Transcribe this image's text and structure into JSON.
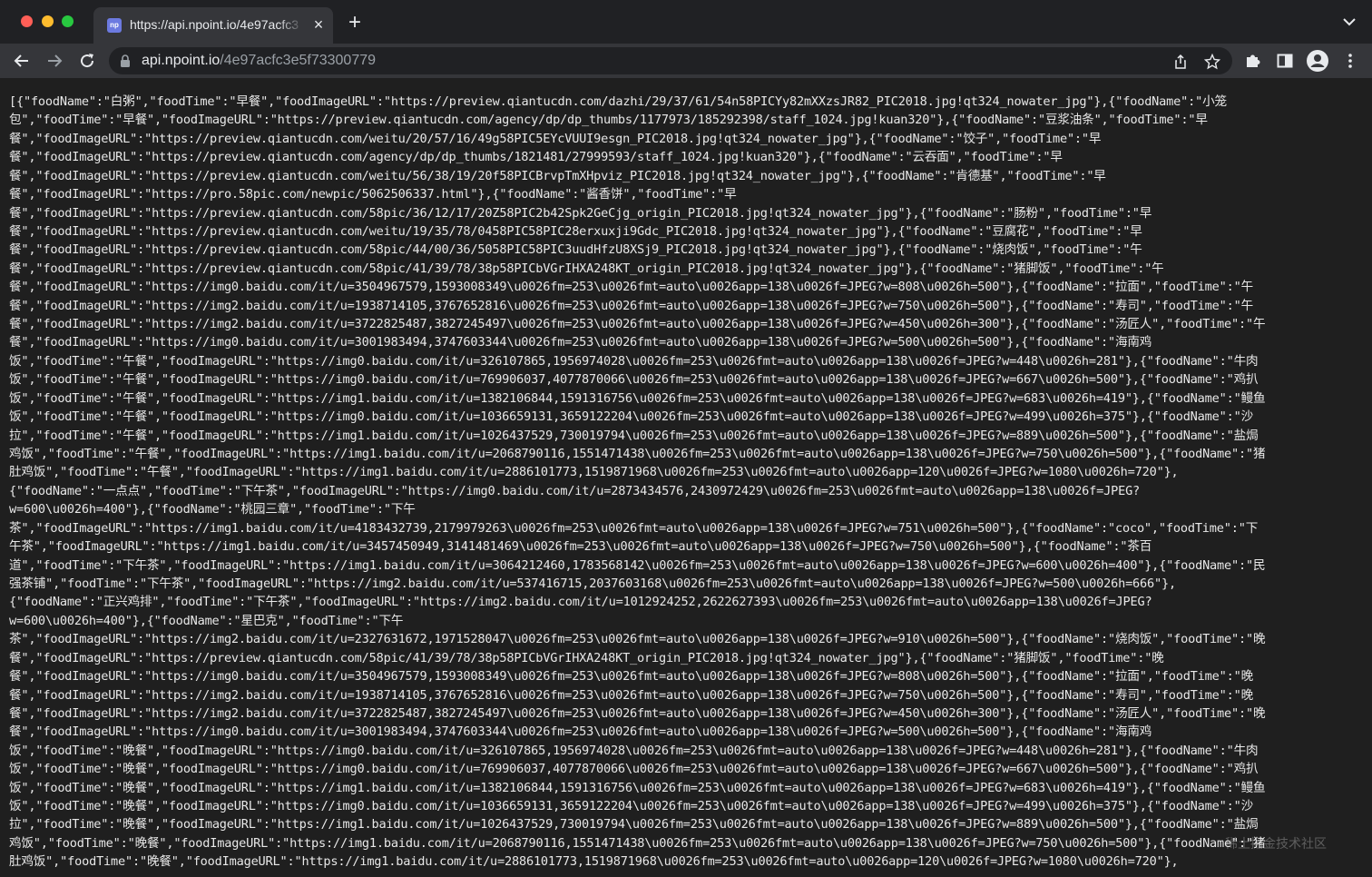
{
  "browser": {
    "tab_title": "https://api.npoint.io/4e97acfc3",
    "favicon_text": "np",
    "url_host": "api.npoint.io",
    "url_path": "/4e97acfc3e5f73300779"
  },
  "content": {
    "lines": [
      "[{\"foodName\":\"白粥\",\"foodTime\":\"早餐\",\"foodImageURL\":\"https://preview.qiantucdn.com/dazhi/29/37/61/54n58PICYy82mXXzsJR82_PIC2018.jpg!qt324_nowater_jpg\"},{\"foodName\":\"小笼",
      "包\",\"foodTime\":\"早餐\",\"foodImageURL\":\"https://preview.qiantucdn.com/agency/dp/dp_thumbs/1177973/185292398/staff_1024.jpg!kuan320\"},{\"foodName\":\"豆浆油条\",\"foodTime\":\"早",
      "餐\",\"foodImageURL\":\"https://preview.qiantucdn.com/weitu/20/57/16/49g58PIC5EYcVUUI9esgn_PIC2018.jpg!qt324_nowater_jpg\"},{\"foodName\":\"饺子\",\"foodTime\":\"早",
      "餐\",\"foodImageURL\":\"https://preview.qiantucdn.com/agency/dp/dp_thumbs/1821481/27999593/staff_1024.jpg!kuan320\"},{\"foodName\":\"云吞面\",\"foodTime\":\"早",
      "餐\",\"foodImageURL\":\"https://preview.qiantucdn.com/weitu/56/38/19/20f58PICBrvpTmXHpviz_PIC2018.jpg!qt324_nowater_jpg\"},{\"foodName\":\"肯德基\",\"foodTime\":\"早",
      "餐\",\"foodImageURL\":\"https://pro.58pic.com/newpic/5062506337.html\"},{\"foodName\":\"酱香饼\",\"foodTime\":\"早",
      "餐\",\"foodImageURL\":\"https://preview.qiantucdn.com/58pic/36/12/17/20Z58PIC2b42Spk2GeCjg_origin_PIC2018.jpg!qt324_nowater_jpg\"},{\"foodName\":\"肠粉\",\"foodTime\":\"早",
      "餐\",\"foodImageURL\":\"https://preview.qiantucdn.com/weitu/19/35/78/0458PIC58PIC28erxuxji9Gdc_PIC2018.jpg!qt324_nowater_jpg\"},{\"foodName\":\"豆腐花\",\"foodTime\":\"早",
      "餐\",\"foodImageURL\":\"https://preview.qiantucdn.com/58pic/44/00/36/5058PIC58PIC3uudHfzU8XSj9_PIC2018.jpg!qt324_nowater_jpg\"},{\"foodName\":\"烧肉饭\",\"foodTime\":\"午",
      "餐\",\"foodImageURL\":\"https://preview.qiantucdn.com/58pic/41/39/78/38p58PICbVGrIHXA248KT_origin_PIC2018.jpg!qt324_nowater_jpg\"},{\"foodName\":\"猪脚饭\",\"foodTime\":\"午",
      "餐\",\"foodImageURL\":\"https://img0.baidu.com/it/u=3504967579,1593008349\\u0026fm=253\\u0026fmt=auto\\u0026app=138\\u0026f=JPEG?w=808\\u0026h=500\"},{\"foodName\":\"拉面\",\"foodTime\":\"午",
      "餐\",\"foodImageURL\":\"https://img2.baidu.com/it/u=1938714105,3767652816\\u0026fm=253\\u0026fmt=auto\\u0026app=138\\u0026f=JPEG?w=750\\u0026h=500\"},{\"foodName\":\"寿司\",\"foodTime\":\"午",
      "餐\",\"foodImageURL\":\"https://img2.baidu.com/it/u=3722825487,3827245497\\u0026fm=253\\u0026fmt=auto\\u0026app=138\\u0026f=JPEG?w=450\\u0026h=300\"},{\"foodName\":\"汤匠人\",\"foodTime\":\"午",
      "餐\",\"foodImageURL\":\"https://img0.baidu.com/it/u=3001983494,3747603344\\u0026fm=253\\u0026fmt=auto\\u0026app=138\\u0026f=JPEG?w=500\\u0026h=500\"},{\"foodName\":\"海南鸡",
      "饭\",\"foodTime\":\"午餐\",\"foodImageURL\":\"https://img0.baidu.com/it/u=326107865,1956974028\\u0026fm=253\\u0026fmt=auto\\u0026app=138\\u0026f=JPEG?w=448\\u0026h=281\"},{\"foodName\":\"牛肉",
      "饭\",\"foodTime\":\"午餐\",\"foodImageURL\":\"https://img0.baidu.com/it/u=769906037,4077870066\\u0026fm=253\\u0026fmt=auto\\u0026app=138\\u0026f=JPEG?w=667\\u0026h=500\"},{\"foodName\":\"鸡扒",
      "饭\",\"foodTime\":\"午餐\",\"foodImageURL\":\"https://img1.baidu.com/it/u=1382106844,1591316756\\u0026fm=253\\u0026fmt=auto\\u0026app=138\\u0026f=JPEG?w=683\\u0026h=419\"},{\"foodName\":\"鳗鱼",
      "饭\",\"foodTime\":\"午餐\",\"foodImageURL\":\"https://img0.baidu.com/it/u=1036659131,3659122204\\u0026fm=253\\u0026fmt=auto\\u0026app=138\\u0026f=JPEG?w=499\\u0026h=375\"},{\"foodName\":\"沙",
      "拉\",\"foodTime\":\"午餐\",\"foodImageURL\":\"https://img1.baidu.com/it/u=1026437529,730019794\\u0026fm=253\\u0026fmt=auto\\u0026app=138\\u0026f=JPEG?w=889\\u0026h=500\"},{\"foodName\":\"盐焗",
      "鸡饭\",\"foodTime\":\"午餐\",\"foodImageURL\":\"https://img1.baidu.com/it/u=2068790116,1551471438\\u0026fm=253\\u0026fmt=auto\\u0026app=138\\u0026f=JPEG?w=750\\u0026h=500\"},{\"foodName\":\"猪",
      "肚鸡饭\",\"foodTime\":\"午餐\",\"foodImageURL\":\"https://img1.baidu.com/it/u=2886101773,1519871968\\u0026fm=253\\u0026fmt=auto\\u0026app=120\\u0026f=JPEG?w=1080\\u0026h=720\"},",
      "{\"foodName\":\"一点点\",\"foodTime\":\"下午茶\",\"foodImageURL\":\"https://img0.baidu.com/it/u=2873434576,2430972429\\u0026fm=253\\u0026fmt=auto\\u0026app=138\\u0026f=JPEG?",
      "w=600\\u0026h=400\"},{\"foodName\":\"桃园三章\",\"foodTime\":\"下午",
      "茶\",\"foodImageURL\":\"https://img1.baidu.com/it/u=4183432739,2179979263\\u0026fm=253\\u0026fmt=auto\\u0026app=138\\u0026f=JPEG?w=751\\u0026h=500\"},{\"foodName\":\"coco\",\"foodTime\":\"下",
      "午茶\",\"foodImageURL\":\"https://img1.baidu.com/it/u=3457450949,3141481469\\u0026fm=253\\u0026fmt=auto\\u0026app=138\\u0026f=JPEG?w=750\\u0026h=500\"},{\"foodName\":\"茶百",
      "道\",\"foodTime\":\"下午茶\",\"foodImageURL\":\"https://img1.baidu.com/it/u=3064212460,1783568142\\u0026fm=253\\u0026fmt=auto\\u0026app=138\\u0026f=JPEG?w=600\\u0026h=400\"},{\"foodName\":\"民",
      "强茶铺\",\"foodTime\":\"下午茶\",\"foodImageURL\":\"https://img2.baidu.com/it/u=537416715,2037603168\\u0026fm=253\\u0026fmt=auto\\u0026app=138\\u0026f=JPEG?w=500\\u0026h=666\"},",
      "{\"foodName\":\"正兴鸡排\",\"foodTime\":\"下午茶\",\"foodImageURL\":\"https://img2.baidu.com/it/u=1012924252,2622627393\\u0026fm=253\\u0026fmt=auto\\u0026app=138\\u0026f=JPEG?",
      "w=600\\u0026h=400\"},{\"foodName\":\"星巴克\",\"foodTime\":\"下午",
      "茶\",\"foodImageURL\":\"https://img2.baidu.com/it/u=2327631672,1971528047\\u0026fm=253\\u0026fmt=auto\\u0026app=138\\u0026f=JPEG?w=910\\u0026h=500\"},{\"foodName\":\"烧肉饭\",\"foodTime\":\"晚",
      "餐\",\"foodImageURL\":\"https://preview.qiantucdn.com/58pic/41/39/78/38p58PICbVGrIHXA248KT_origin_PIC2018.jpg!qt324_nowater_jpg\"},{\"foodName\":\"猪脚饭\",\"foodTime\":\"晚",
      "餐\",\"foodImageURL\":\"https://img0.baidu.com/it/u=3504967579,1593008349\\u0026fm=253\\u0026fmt=auto\\u0026app=138\\u0026f=JPEG?w=808\\u0026h=500\"},{\"foodName\":\"拉面\",\"foodTime\":\"晚",
      "餐\",\"foodImageURL\":\"https://img2.baidu.com/it/u=1938714105,3767652816\\u0026fm=253\\u0026fmt=auto\\u0026app=138\\u0026f=JPEG?w=750\\u0026h=500\"},{\"foodName\":\"寿司\",\"foodTime\":\"晚",
      "餐\",\"foodImageURL\":\"https://img2.baidu.com/it/u=3722825487,3827245497\\u0026fm=253\\u0026fmt=auto\\u0026app=138\\u0026f=JPEG?w=450\\u0026h=300\"},{\"foodName\":\"汤匠人\",\"foodTime\":\"晚",
      "餐\",\"foodImageURL\":\"https://img0.baidu.com/it/u=3001983494,3747603344\\u0026fm=253\\u0026fmt=auto\\u0026app=138\\u0026f=JPEG?w=500\\u0026h=500\"},{\"foodName\":\"海南鸡",
      "饭\",\"foodTime\":\"晚餐\",\"foodImageURL\":\"https://img0.baidu.com/it/u=326107865,1956974028\\u0026fm=253\\u0026fmt=auto\\u0026app=138\\u0026f=JPEG?w=448\\u0026h=281\"},{\"foodName\":\"牛肉",
      "饭\",\"foodTime\":\"晚餐\",\"foodImageURL\":\"https://img0.baidu.com/it/u=769906037,4077870066\\u0026fm=253\\u0026fmt=auto\\u0026app=138\\u0026f=JPEG?w=667\\u0026h=500\"},{\"foodName\":\"鸡扒",
      "饭\",\"foodTime\":\"晚餐\",\"foodImageURL\":\"https://img1.baidu.com/it/u=1382106844,1591316756\\u0026fm=253\\u0026fmt=auto\\u0026app=138\\u0026f=JPEG?w=683\\u0026h=419\"},{\"foodName\":\"鳗鱼",
      "饭\",\"foodTime\":\"晚餐\",\"foodImageURL\":\"https://img0.baidu.com/it/u=1036659131,3659122204\\u0026fm=253\\u0026fmt=auto\\u0026app=138\\u0026f=JPEG?w=499\\u0026h=375\"},{\"foodName\":\"沙",
      "拉\",\"foodTime\":\"晚餐\",\"foodImageURL\":\"https://img1.baidu.com/it/u=1026437529,730019794\\u0026fm=253\\u0026fmt=auto\\u0026app=138\\u0026f=JPEG?w=889\\u0026h=500\"},{\"foodName\":\"盐焗",
      "鸡饭\",\"foodTime\":\"晚餐\",\"foodImageURL\":\"https://img1.baidu.com/it/u=2068790116,1551471438\\u0026fm=253\\u0026fmt=auto\\u0026app=138\\u0026f=JPEG?w=750\\u0026h=500\"},{\"foodName\":\"猪",
      "肚鸡饭\",\"foodTime\":\"晚餐\",\"foodImageURL\":\"https://img1.baidu.com/it/u=2886101773,1519871968\\u0026fm=253\\u0026fmt=auto\\u0026app=120\\u0026f=JPEG?w=1080\\u0026h=720\"},"
    ],
    "watermark": "稀土掘金技术社区"
  }
}
